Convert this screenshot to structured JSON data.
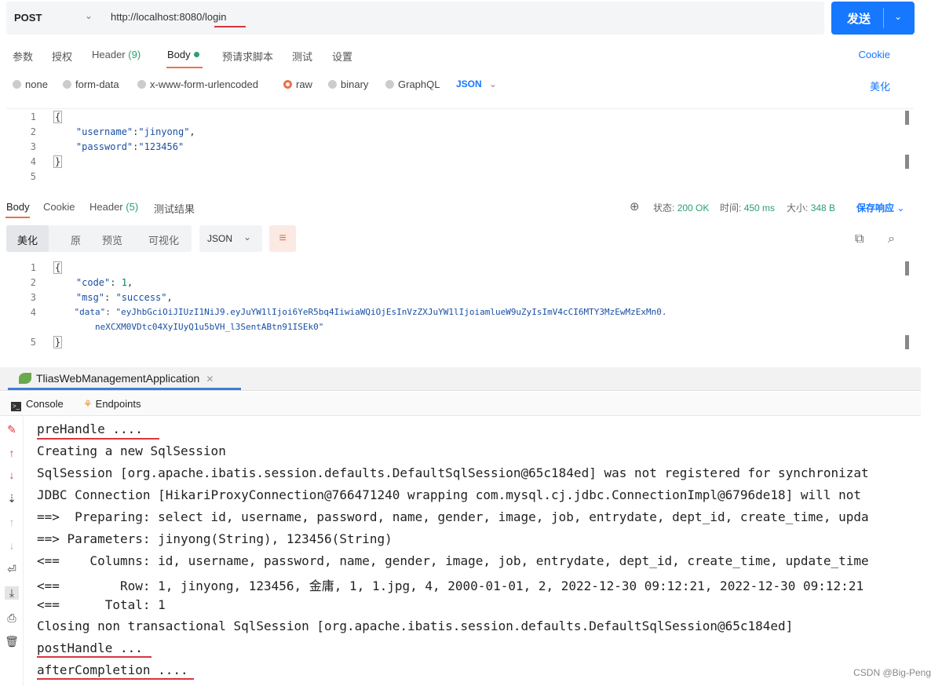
{
  "request": {
    "method": "POST",
    "url": "http://localhost:8080/login",
    "send_label": "发送"
  },
  "request_tabs": {
    "params": "参数",
    "auth": "授权",
    "header": "Header",
    "header_count": "(9)",
    "body": "Body",
    "prerequest": "预请求脚本",
    "tests": "测试",
    "settings": "设置",
    "cookie": "Cookie"
  },
  "body_types": {
    "none": "none",
    "form_data": "form-data",
    "urlencoded": "x-www-form-urlencoded",
    "raw": "raw",
    "binary": "binary",
    "graphql": "GraphQL",
    "format": "JSON",
    "beautify": "美化"
  },
  "request_body": {
    "line_numbers": [
      "1",
      "2",
      "3",
      "4",
      "5"
    ],
    "open": "{",
    "username_key": "\"username\"",
    "username_val": "\"jinyong\"",
    "password_key": "\"password\"",
    "password_val": "\"123456\"",
    "close": "}"
  },
  "response_tabs": {
    "body": "Body",
    "cookie": "Cookie",
    "header": "Header",
    "header_count": "(5)",
    "test_results": "测试结果",
    "status_label": "状态:",
    "status_value": "200 OK",
    "time_label": "时间:",
    "time_value": "450 ms",
    "size_label": "大小:",
    "size_value": "348 B",
    "save_response": "保存响应"
  },
  "response_view": {
    "pretty": "美化",
    "raw": "原",
    "preview": "预览",
    "visualize": "可视化",
    "format": "JSON"
  },
  "response_body": {
    "line_numbers": [
      "1",
      "2",
      "3",
      "4",
      "5"
    ],
    "open": "{",
    "code_key": "\"code\"",
    "code_val": "1",
    "msg_key": "\"msg\"",
    "msg_val": "\"success\"",
    "data_key": "\"data\"",
    "data_val_1": "\"eyJhbGciOiJIUzI1NiJ9.eyJuYW1lIjoi6YeR5bq4IiwiaWQiOjEsInVzZXJuYW1lIjoiamlueW9uZyIsImV4cCI6MTY3MzEwMzExMn0.",
    "data_val_2": "neXCXM0VDtc04XyIUyQ1u5bVH_l3SentABtn91ISEk0\"",
    "close": "}"
  },
  "ide": {
    "app_tab": "TliasWebManagementApplication",
    "console_tab": "Console",
    "endpoints_tab": "Endpoints",
    "lines": [
      "preHandle ....",
      "Creating a new SqlSession",
      "SqlSession [org.apache.ibatis.session.defaults.DefaultSqlSession@65c184ed] was not registered for synchronizat",
      "JDBC Connection [HikariProxyConnection@766471240 wrapping com.mysql.cj.jdbc.ConnectionImpl@6796de18] will not",
      "==>  Preparing: select id, username, password, name, gender, image, job, entrydate, dept_id, create_time, upda",
      "==> Parameters: jinyong(String), 123456(String)",
      "<==    Columns: id, username, password, name, gender, image, job, entrydate, dept_id, create_time, update_time",
      "<==        Row: 1, jinyong, 123456, 金庸, 1, 1.jpg, 4, 2000-01-01, 2, 2022-12-30 09:12:21, 2022-12-30 09:12:21",
      "<==      Total: 1",
      "Closing non transactional SqlSession [org.apache.ibatis.session.defaults.DefaultSqlSession@65c184ed]",
      "postHandle ...",
      "afterCompletion ...."
    ]
  },
  "watermark": "CSDN @Big-Peng",
  "colors": {
    "accent": "#1677ff",
    "highlight": "#e8734a",
    "success": "#2aa06e",
    "annotation": "#d9363e"
  }
}
